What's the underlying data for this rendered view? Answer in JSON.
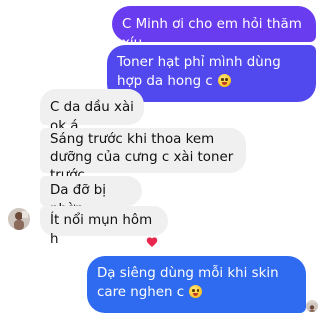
{
  "colors": {
    "outgoing_top": "#6a3cf0",
    "outgoing_mid": "#5148ee",
    "outgoing_bottom": "#2f6bf0",
    "incoming_bg": "#f1f0f0",
    "heart": "#e8264e"
  },
  "messages": [
    {
      "id": "m1",
      "side": "out",
      "text": "C Minh ơi cho em hỏi thăm xíu"
    },
    {
      "id": "m2",
      "side": "out",
      "text": "Toner hạt phỉ mình dùng hợp da hong c",
      "emoji": "grinning-face-emoji"
    },
    {
      "id": "m3",
      "side": "in",
      "text": "C da dầu xài ok á"
    },
    {
      "id": "m4",
      "side": "in",
      "text": "Sáng trước khi thoa kem dưỡng của cưng c xài toner trước"
    },
    {
      "id": "m5",
      "side": "in",
      "text": "Da đỡ bị nhờn"
    },
    {
      "id": "m6",
      "side": "in",
      "text": "Ít nổi mụn hôm h"
    },
    {
      "id": "m7",
      "side": "out",
      "text": "Dạ siêng dùng mỗi khi skin care nghen c",
      "emoji": "grinning-face-emoji"
    }
  ],
  "reaction": {
    "icon": "heart-icon"
  }
}
